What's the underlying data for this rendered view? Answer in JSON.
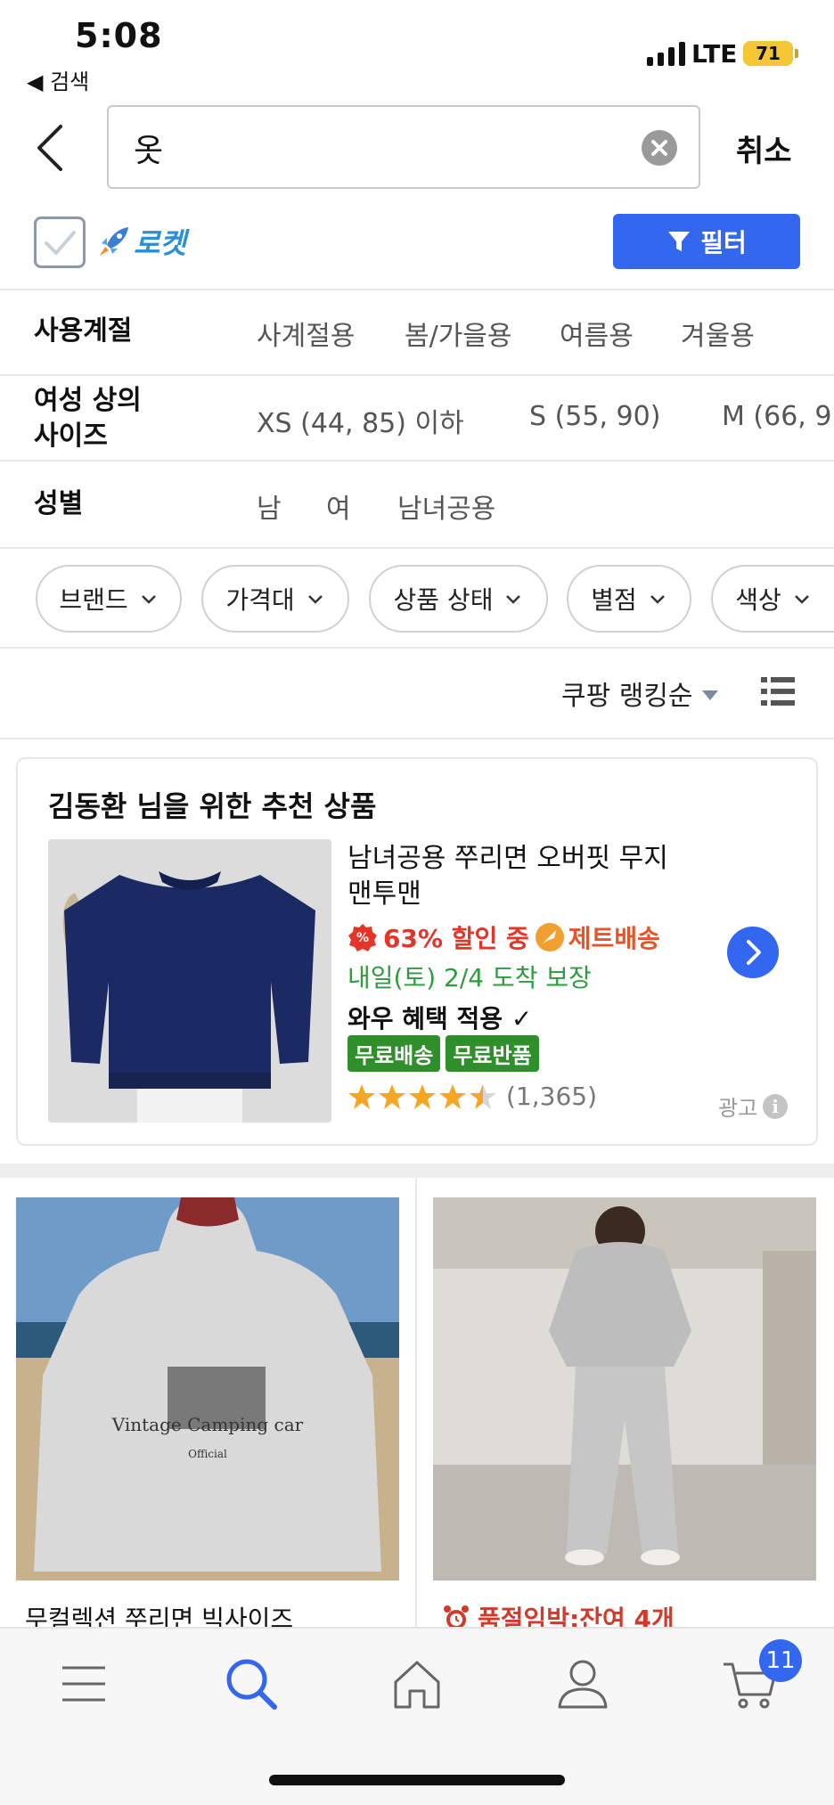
{
  "status": {
    "time": "5:08",
    "back_app": "◀ 검색",
    "network": "LTE",
    "battery": "71"
  },
  "search": {
    "query": "옷",
    "cancel_label": "취소"
  },
  "rocket": {
    "label": "로켓"
  },
  "filter_button": {
    "label": "필터"
  },
  "filters": {
    "season": {
      "label": "사용계절",
      "options": [
        "사계절용",
        "봄/가을용",
        "여름용",
        "겨울용"
      ]
    },
    "size": {
      "label_line1": "여성 상의",
      "label_line2": "사이즈",
      "options": [
        "XS (44, 85) 이하",
        "S (55, 90)",
        "M (66, 9"
      ]
    },
    "gender": {
      "label": "성별",
      "options": [
        "남",
        "여",
        "남녀공용"
      ]
    }
  },
  "chips": [
    "브랜드",
    "가격대",
    "상품 상태",
    "별점",
    "색상"
  ],
  "sort": {
    "label": "쿠팡 랭킹순"
  },
  "recommendation": {
    "title": "김동환 님을 위한 추천 상품",
    "product_name": "남녀공용 쭈리면 오버핏 무지 맨투맨",
    "discount": "63% 할인 중",
    "delivery_type": "제트배송",
    "arrival": "내일(토) 2/4 도착 보장",
    "wow": "와우 혜택 적용",
    "tags": [
      "무료배송",
      "무료반품"
    ],
    "rating": 4.5,
    "review_count": "(1,365)",
    "ad_label": "광고",
    "colors": {
      "sweatshirt": "#1b2a63",
      "discount_red": "#e4352a",
      "jet_orange": "#e4552a",
      "arrival_green": "#2e9b3e"
    }
  },
  "products": [
    {
      "title": "무컬렉션 쭈리면 빅사이즈",
      "image_text_1": "Vintage Camping car",
      "image_text_2": "Official"
    },
    {
      "alert": "품절임박:잔여 4개"
    }
  ],
  "tabbar": {
    "items": [
      "menu",
      "search",
      "home",
      "my",
      "cart"
    ],
    "cart_count": "11"
  },
  "accent": "#3467f0"
}
